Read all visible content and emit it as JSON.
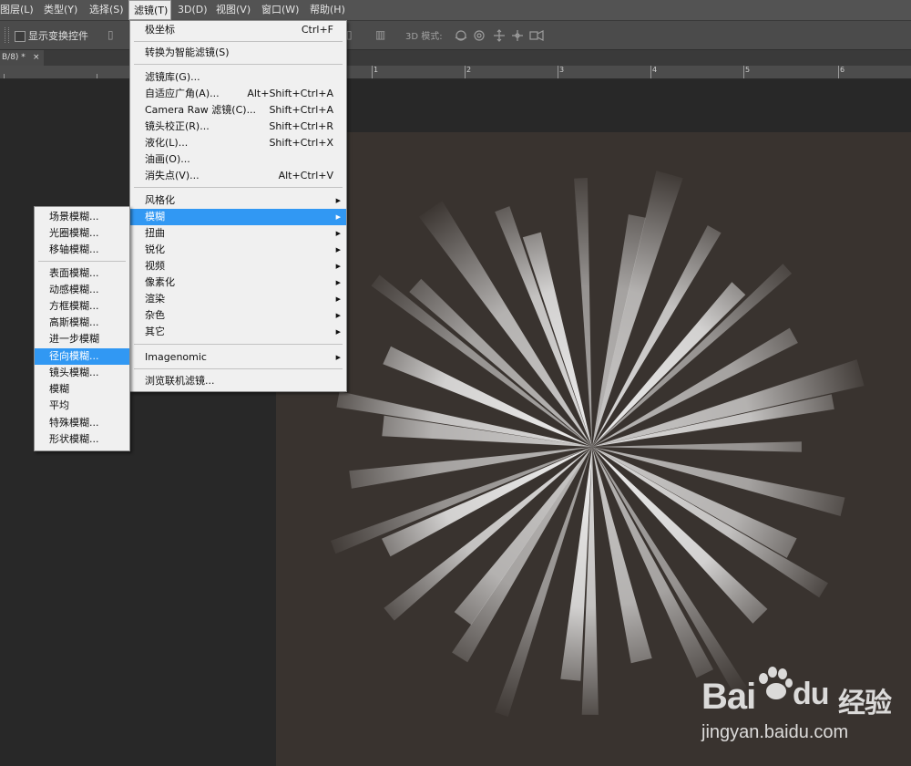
{
  "menubar": {
    "items": [
      "图层(L)",
      "类型(Y)",
      "选择(S)",
      "滤镜(T)",
      "3D(D)",
      "视图(V)",
      "窗口(W)",
      "帮助(H)"
    ],
    "active_index": 3
  },
  "options_bar": {
    "show_transform_controls": "显示变换控件",
    "mode_label": "3D 模式:"
  },
  "document_tab": {
    "title": "B/8) *",
    "close_glyph": "×"
  },
  "ruler": {
    "ticks": [
      "1",
      "2",
      "3",
      "4",
      "5",
      "6"
    ]
  },
  "filter_menu": {
    "items": [
      {
        "label": "极坐标",
        "shortcut": "Ctrl+F"
      },
      {
        "label": "转换为智能滤镜(S)",
        "shortcut": ""
      },
      {
        "label": "滤镜库(G)...",
        "shortcut": ""
      },
      {
        "label": "自适应广角(A)...",
        "shortcut": "Alt+Shift+Ctrl+A"
      },
      {
        "label": "Camera Raw 滤镜(C)...",
        "shortcut": "Shift+Ctrl+A"
      },
      {
        "label": "镜头校正(R)...",
        "shortcut": "Shift+Ctrl+R"
      },
      {
        "label": "液化(L)...",
        "shortcut": "Shift+Ctrl+X"
      },
      {
        "label": "油画(O)...",
        "shortcut": ""
      },
      {
        "label": "消失点(V)...",
        "shortcut": "Alt+Ctrl+V"
      },
      {
        "label": "风格化",
        "shortcut": ""
      },
      {
        "label": "模糊",
        "shortcut": ""
      },
      {
        "label": "扭曲",
        "shortcut": ""
      },
      {
        "label": "锐化",
        "shortcut": ""
      },
      {
        "label": "视频",
        "shortcut": ""
      },
      {
        "label": "像素化",
        "shortcut": ""
      },
      {
        "label": "渲染",
        "shortcut": ""
      },
      {
        "label": "杂色",
        "shortcut": ""
      },
      {
        "label": "其它",
        "shortcut": ""
      },
      {
        "label": "Imagenomic",
        "shortcut": ""
      },
      {
        "label": "浏览联机滤镜...",
        "shortcut": ""
      }
    ],
    "highlighted": "模糊",
    "submenu_arrow": "▶"
  },
  "blur_submenu": {
    "items": [
      "场景模糊...",
      "光圈模糊...",
      "移轴模糊...",
      "表面模糊...",
      "动感模糊...",
      "方框模糊...",
      "高斯模糊...",
      "进一步模糊",
      "径向模糊...",
      "镜头模糊...",
      "模糊",
      "平均",
      "特殊模糊...",
      "形状模糊..."
    ],
    "highlighted": "径向模糊..."
  },
  "watermark": {
    "brand": "Bai",
    "brand_suffix": "du",
    "brand_cn": "经验",
    "url": "jingyan.baidu.com"
  },
  "colors": {
    "menubar_bg": "#535353",
    "menu_bg": "#f0f0f0",
    "highlight": "#3198f3",
    "canvas_bg": "#39332f",
    "pasteboard_bg": "#282828"
  }
}
